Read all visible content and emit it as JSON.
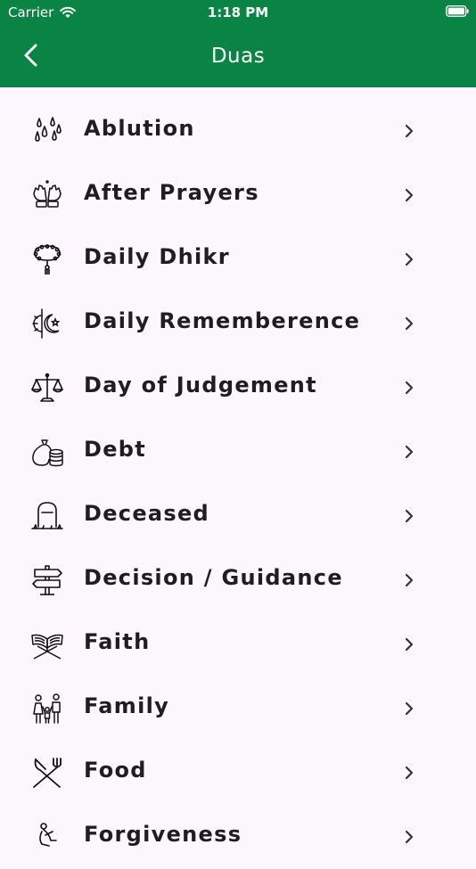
{
  "status_bar": {
    "carrier": "Carrier",
    "time": "1:18 PM"
  },
  "nav": {
    "title": "Duas"
  },
  "colors": {
    "header_green": "#0a8444",
    "background": "#fbf7fd",
    "text": "#1e1e1e"
  },
  "categories": [
    {
      "label": "Ablution",
      "icon": "water-drops-icon"
    },
    {
      "label": "After Prayers",
      "icon": "praying-hands-icon"
    },
    {
      "label": "Daily Dhikr",
      "icon": "prayer-beads-icon"
    },
    {
      "label": "Daily Rememberence",
      "icon": "sun-moon-icon"
    },
    {
      "label": "Day of Judgement",
      "icon": "scales-icon"
    },
    {
      "label": "Debt",
      "icon": "money-bag-coins-icon"
    },
    {
      "label": "Deceased",
      "icon": "grave-icon"
    },
    {
      "label": "Decision / Guidance",
      "icon": "signpost-icon"
    },
    {
      "label": "Faith",
      "icon": "quran-stand-icon"
    },
    {
      "label": "Family",
      "icon": "family-icon"
    },
    {
      "label": "Food",
      "icon": "fork-knife-icon"
    },
    {
      "label": "Forgiveness",
      "icon": "kneeling-person-icon"
    }
  ]
}
